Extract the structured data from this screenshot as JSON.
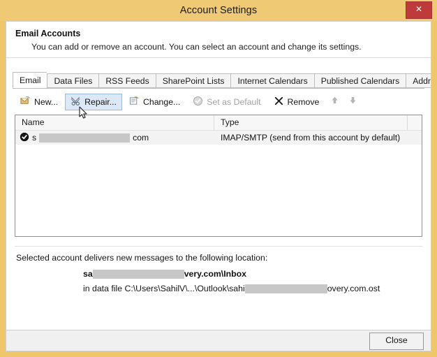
{
  "window": {
    "title": "Account Settings",
    "close_icon": "close-x-icon",
    "close_icon_glyph": "✕",
    "titlebar_color": "#f0c975",
    "close_button_color": "#bf3b3b"
  },
  "header": {
    "title": "Email Accounts",
    "subtitle": "You can add or remove an account. You can select an account and change its settings."
  },
  "tabs": [
    {
      "label": "Email",
      "active": true
    },
    {
      "label": "Data Files",
      "active": false
    },
    {
      "label": "RSS Feeds",
      "active": false
    },
    {
      "label": "SharePoint Lists",
      "active": false
    },
    {
      "label": "Internet Calendars",
      "active": false
    },
    {
      "label": "Published Calendars",
      "active": false
    },
    {
      "label": "Address Books",
      "active": false
    }
  ],
  "toolbar": {
    "new_label": "New...",
    "repair_label": "Repair...",
    "change_label": "Change...",
    "set_default_label": "Set as Default",
    "remove_label": "Remove",
    "move_up_label": "",
    "move_down_label": "",
    "hover_highlight_color": "#dce8f6"
  },
  "accounts_list": {
    "columns": [
      "Name",
      "Type",
      ""
    ],
    "rows": [
      {
        "name_prefix": "s",
        "name_suffix": "com",
        "name_redacted": true,
        "type": "IMAP/SMTP (send from this account by default)",
        "is_default": true,
        "selected": true
      }
    ]
  },
  "delivery_info": {
    "heading": "Selected account delivers new messages to the following location:",
    "mailbox_prefix": "sa",
    "mailbox_suffix": "very.com\\Inbox",
    "datafile_prefix": "in data file C:\\Users\\SahilV\\...\\Outlook\\sahi",
    "datafile_suffix": "overy.com.ost"
  },
  "footer": {
    "close_label": "Close"
  }
}
